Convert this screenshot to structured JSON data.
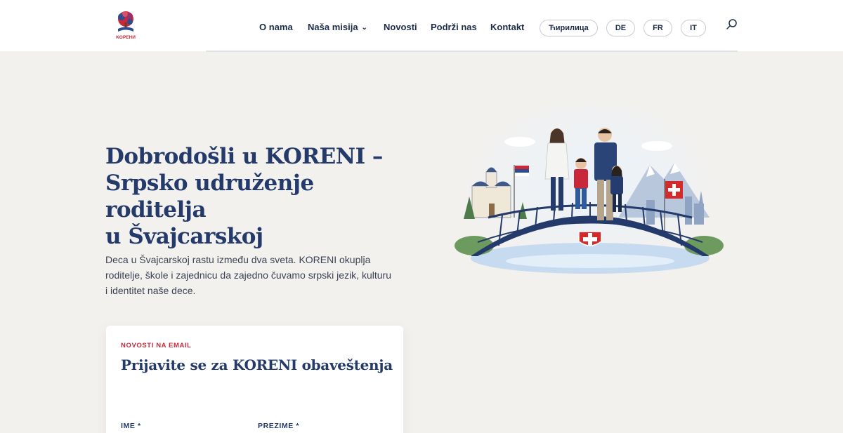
{
  "header": {
    "logo_text": "KOPEHИ",
    "nav": {
      "about": "O nama",
      "mission": "Naša misija",
      "news": "Novosti",
      "support": "Podrži nas",
      "contact": "Kontakt"
    },
    "languages": {
      "cyrillic": "Ћирилица",
      "de": "DE",
      "fr": "FR",
      "it": "IT"
    },
    "icons": {
      "search": "search-icon",
      "dropdown": "chevron-down-icon"
    }
  },
  "hero": {
    "title_line1": "Dobrodošli u KORENI –",
    "title_line2": "Srpsko udruženje roditelja",
    "title_line3": "u Švajcarskoj",
    "text_line1": "Deca u Švajcarskoj rastu između dva sveta. KORENI okuplja",
    "text_line2": "roditelje, škole i zajednicu da zajedno čuvamo srpski jezik, kulturu",
    "text_line3": "i identitet naše dece."
  },
  "signup": {
    "kicker": "NOVOSTI NA EMAIL",
    "title": "Prijavite se za KORENI obaveštenja",
    "first_name_label": "IME *",
    "last_name_label": "PREZIME *"
  },
  "colors": {
    "brand_navy": "#233a6b",
    "accent_red": "#c8283a",
    "background": "#f3f1ee"
  }
}
